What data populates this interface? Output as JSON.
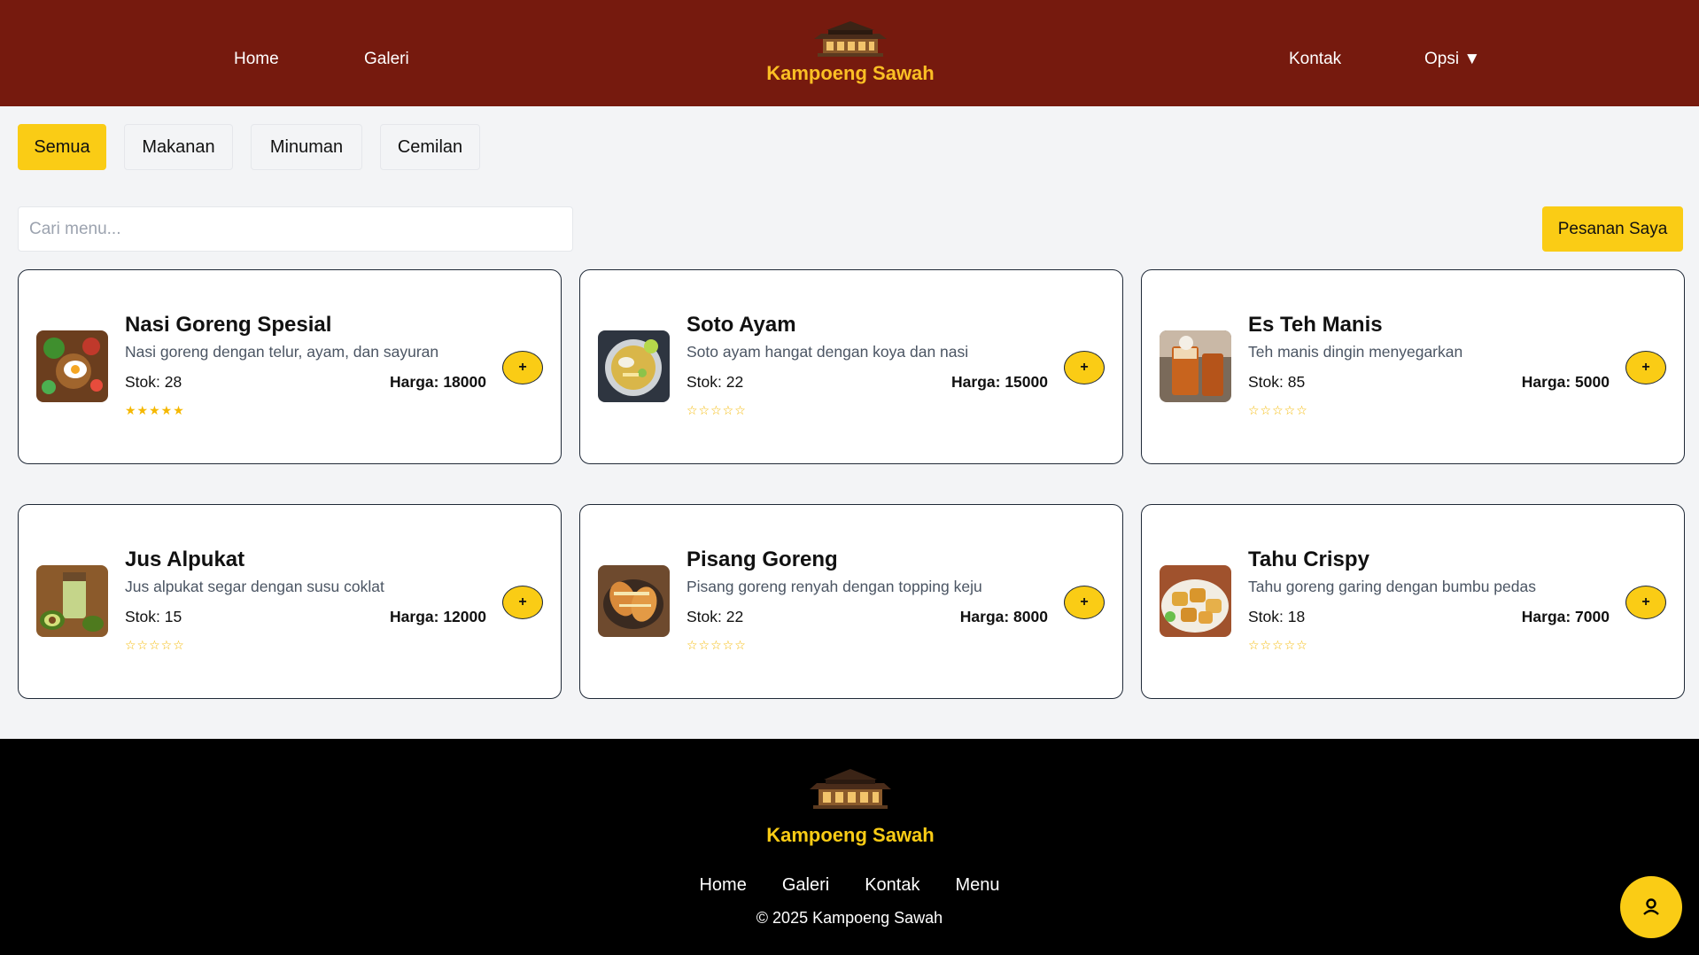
{
  "header": {
    "nav_left": [
      "Home",
      "Galeri"
    ],
    "nav_right": [
      "Kontak",
      "Opsi ▼"
    ],
    "brand": "Kampoeng Sawah"
  },
  "filters": [
    "Semua",
    "Makanan",
    "Minuman",
    "Cemilan"
  ],
  "active_filter": "Semua",
  "search": {
    "placeholder": "Cari menu..."
  },
  "orders_button": "Pesanan Saya",
  "menu": [
    {
      "name": "Nasi Goreng Spesial",
      "desc": "Nasi goreng dengan telur, ayam, dan sayuran",
      "stock": "Stok: 28",
      "price": "Harga: 18000",
      "rating": "★★★★★",
      "image_icon": "fried-rice-photo"
    },
    {
      "name": "Soto Ayam",
      "desc": "Soto ayam hangat dengan koya dan nasi",
      "stock": "Stok: 22",
      "price": "Harga: 15000",
      "rating": "☆☆☆☆☆",
      "image_icon": "soup-photo"
    },
    {
      "name": "Es Teh Manis",
      "desc": "Teh manis dingin menyegarkan",
      "stock": "Stok: 85",
      "price": "Harga: 5000",
      "rating": "☆☆☆☆☆",
      "image_icon": "iced-tea-photo"
    },
    {
      "name": "Jus Alpukat",
      "desc": "Jus alpukat segar dengan susu coklat",
      "stock": "Stok: 15",
      "price": "Harga: 12000",
      "rating": "☆☆☆☆☆",
      "image_icon": "avocado-juice-photo"
    },
    {
      "name": "Pisang Goreng",
      "desc": "Pisang goreng renyah dengan topping keju",
      "stock": "Stok: 22",
      "price": "Harga: 8000",
      "rating": "☆☆☆☆☆",
      "image_icon": "fried-banana-photo"
    },
    {
      "name": "Tahu Crispy",
      "desc": "Tahu goreng garing dengan bumbu pedas",
      "stock": "Stok: 18",
      "price": "Harga: 7000",
      "rating": "☆☆☆☆☆",
      "image_icon": "crispy-tofu-photo"
    }
  ],
  "add_label": "+",
  "footer": {
    "brand": "Kampoeng Sawah",
    "links": [
      "Home",
      "Galeri",
      "Kontak",
      "Menu"
    ],
    "copyright": "© 2025 Kampoeng Sawah"
  },
  "fab_icon": "user-icon",
  "colors": {
    "header_bg": "#761a0e",
    "accent": "#facc15",
    "footer_bg": "#000000",
    "page_bg": "#f3f4f6"
  }
}
